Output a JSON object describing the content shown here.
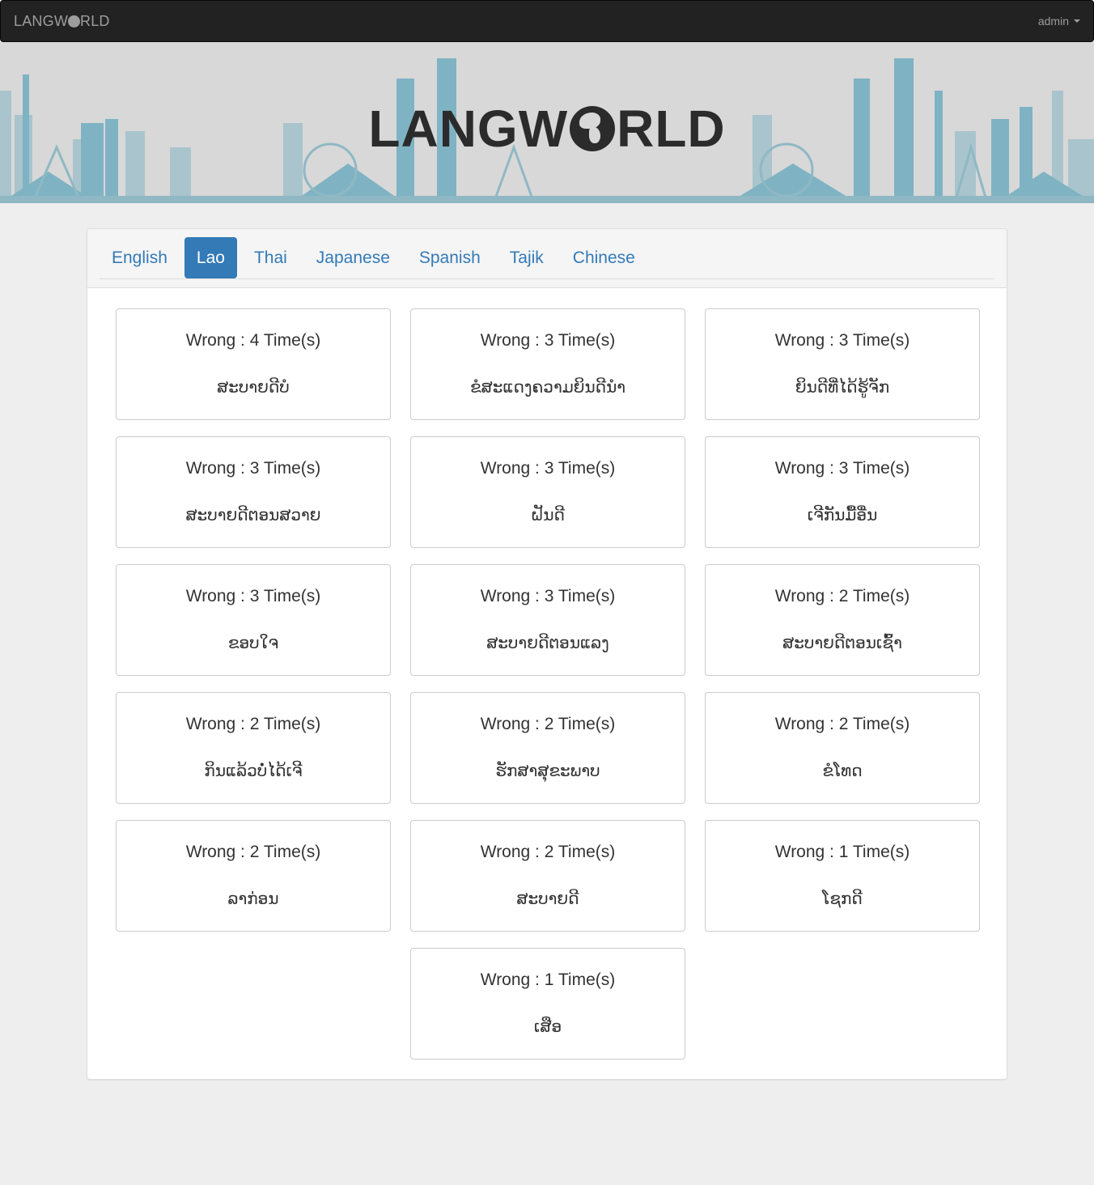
{
  "navbar": {
    "brand": "LANGW",
    "brand_end": "RLD",
    "user": "admin"
  },
  "banner": {
    "logo_start": "LANGW",
    "logo_end": "RLD"
  },
  "tabs": [
    {
      "label": "English",
      "active": false
    },
    {
      "label": "Lao",
      "active": true
    },
    {
      "label": "Thai",
      "active": false
    },
    {
      "label": "Japanese",
      "active": false
    },
    {
      "label": "Spanish",
      "active": false
    },
    {
      "label": "Tajik",
      "active": false
    },
    {
      "label": "Chinese",
      "active": false
    }
  ],
  "cards": [
    {
      "count": "Wrong : 4 Time(s)",
      "word": "ສະບາຍດີບໍ"
    },
    {
      "count": "Wrong : 3 Time(s)",
      "word": "ຂໍສະແດງຄວາມຍິນດີນຳ"
    },
    {
      "count": "Wrong : 3 Time(s)",
      "word": "ຍິນດີທີ່ໄດ້ຮູ້ຈັກ"
    },
    {
      "count": "Wrong : 3 Time(s)",
      "word": "ສະບາຍດີຕອນສວາຍ"
    },
    {
      "count": "Wrong : 3 Time(s)",
      "word": "ຝັນດີ"
    },
    {
      "count": "Wrong : 3 Time(s)",
      "word": "ເຈີກັນມື້ອື່ນ"
    },
    {
      "count": "Wrong : 3 Time(s)",
      "word": "ຂອບໃຈ"
    },
    {
      "count": "Wrong : 3 Time(s)",
      "word": "ສະບາຍດີຕອນແລງ"
    },
    {
      "count": "Wrong : 2 Time(s)",
      "word": "ສະບາຍດີຕອນເຊົ້າ"
    },
    {
      "count": "Wrong : 2 Time(s)",
      "word": "ກິນແລ້ວບໍ່ໄດ້ເຈີ"
    },
    {
      "count": "Wrong : 2 Time(s)",
      "word": "ຮັກສາສຸຂະພາບ"
    },
    {
      "count": "Wrong : 2 Time(s)",
      "word": "ຂໍໂທດ"
    },
    {
      "count": "Wrong : 2 Time(s)",
      "word": "ລາກ່ອນ"
    },
    {
      "count": "Wrong : 2 Time(s)",
      "word": "ສະບາຍດີ"
    },
    {
      "count": "Wrong : 1 Time(s)",
      "word": "ໂຊກດີ"
    },
    {
      "count": "Wrong : 1 Time(s)",
      "word": "ເສືອ"
    }
  ],
  "colors": {
    "navbar": "#222222",
    "link": "#337ab7",
    "banner_teal": "#7fb3c3"
  }
}
